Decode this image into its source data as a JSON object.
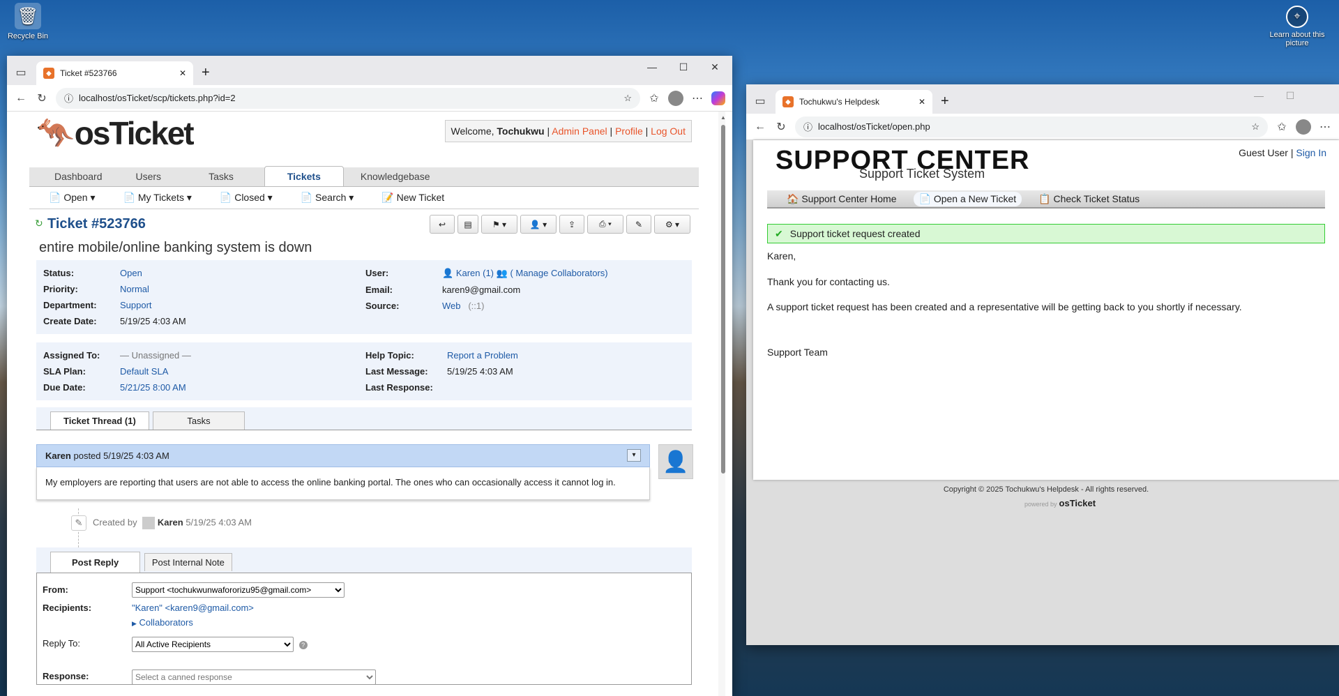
{
  "desktop": {
    "recycle_label": "Recycle Bin",
    "learn_label": "Learn about this picture"
  },
  "left": {
    "tab_title": "Ticket #523766",
    "url": "localhost/osTicket/scp/tickets.php?id=2",
    "logo": "osTicket",
    "welcome_prefix": "Welcome, ",
    "username": "Tochukwu",
    "admin_panel": "Admin Panel",
    "profile": "Profile",
    "logout": "Log Out",
    "nav": [
      "Dashboard",
      "Users",
      "Tasks",
      "Tickets",
      "Knowledgebase"
    ],
    "subnav": [
      "Open",
      "My Tickets",
      "Closed",
      "Search",
      "New Ticket"
    ],
    "ticket_title": "Ticket #523766",
    "subject": "entire mobile/online banking system is down",
    "info1": {
      "left": [
        {
          "k": "Status:",
          "v": "Open"
        },
        {
          "k": "Priority:",
          "v": "Normal"
        },
        {
          "k": "Department:",
          "v": "Support"
        },
        {
          "k": "Create Date:",
          "v": "5/19/25 4:03 AM"
        }
      ],
      "right": [
        {
          "k": "User:",
          "v": "Karen (1)"
        },
        {
          "k": "Email:",
          "v": "karen9@gmail.com"
        },
        {
          "k": "Source:",
          "v": "Web"
        }
      ],
      "manage": "( Manage Collaborators)",
      "source_extra": "(::1)"
    },
    "info2": {
      "left": [
        {
          "k": "Assigned To:",
          "v": "— Unassigned —"
        },
        {
          "k": "SLA Plan:",
          "v": "Default SLA"
        },
        {
          "k": "Due Date:",
          "v": "5/21/25 8:00 AM"
        }
      ],
      "right": [
        {
          "k": "Help Topic:",
          "v": "Report a Problem"
        },
        {
          "k": "Last Message:",
          "v": "5/19/25 4:03 AM"
        },
        {
          "k": "Last Response:",
          "v": ""
        }
      ]
    },
    "thread_tabs": [
      "Ticket Thread (1)",
      "Tasks"
    ],
    "post_author": "Karen",
    "post_meta": "posted 5/19/25 4:03 AM",
    "post_body": "My employers are reporting that users are not able to access the online banking portal. The ones who can occasionally access it cannot log in.",
    "event_created_by": "Created by",
    "event_user": "Karen",
    "event_time": "5/19/25 4:03 AM",
    "reply_tabs": [
      "Post Reply",
      "Post Internal Note"
    ],
    "from_label": "From:",
    "from_value": "Support <tochukwunwafororizu95@gmail.com>",
    "recipients_label": "Recipients:",
    "recipients_value": "\"Karen\" <karen9@gmail.com>",
    "collaborators": "Collaborators",
    "replyto_label": "Reply To:",
    "replyto_value": "All Active Recipients",
    "response_label": "Response:",
    "response_placeholder": "Select a canned response"
  },
  "right": {
    "tab_title": "Tochukwu's Helpdesk",
    "url": "localhost/osTicket/open.php",
    "brand_title": "SUPPORT CENTER",
    "brand_sub": "Support Ticket System",
    "guest": "Guest User",
    "signin": "Sign In",
    "nav": [
      "Support Center Home",
      "Open a New Ticket",
      "Check Ticket Status"
    ],
    "notice": "Support ticket request created",
    "greeting": "Karen,",
    "thanks": "Thank you for contacting us.",
    "message": "A support ticket request has been created and a representative will be getting back to you shortly if necessary.",
    "signoff": "Support Team",
    "copyright": "Copyright © 2025 Tochukwu's Helpdesk - All rights reserved.",
    "powered": "powered by",
    "powered_logo": "osTicket"
  }
}
